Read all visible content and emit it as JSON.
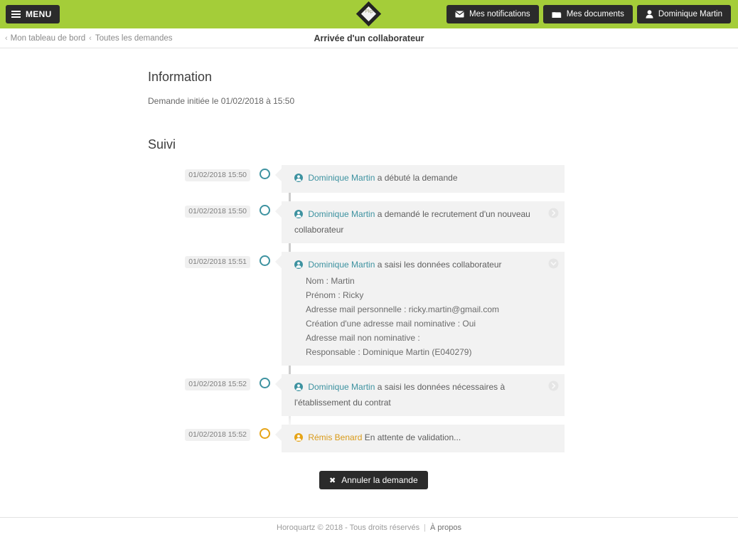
{
  "colors": {
    "brand_green": "#a4cd39",
    "dark": "#2b2b2b",
    "teal": "#3d92a0",
    "amber": "#e6a417",
    "card_bg": "#f2f2f2"
  },
  "header": {
    "menu_label": "MENU",
    "logo_text": "Pkp",
    "actions": [
      {
        "label": "Mes notifications",
        "icon": "envelope-icon"
      },
      {
        "label": "Mes documents",
        "icon": "folder-icon"
      },
      {
        "label": "Dominique Martin",
        "icon": "user-icon"
      }
    ]
  },
  "breadcrumb": {
    "items": [
      "Mon tableau de bord",
      "Toutes les demandes"
    ],
    "chevron": "‹"
  },
  "page_title": "Arrivée d'un collaborateur",
  "information": {
    "heading": "Information",
    "line": "Demande initiée le 01/02/2018 à 15:50"
  },
  "suivi": {
    "heading": "Suivi",
    "events": [
      {
        "time": "01/02/2018 15:50",
        "actor": "Dominique Martin",
        "action": "a débuté la demande",
        "state": "done",
        "toggle": null,
        "details": []
      },
      {
        "time": "01/02/2018 15:50",
        "actor": "Dominique Martin",
        "action": "a demandé le recrutement d'un nouveau collaborateur",
        "state": "done",
        "toggle": "chevron-right-icon",
        "details": []
      },
      {
        "time": "01/02/2018 15:51",
        "actor": "Dominique Martin",
        "action": "a saisi les données collaborateur",
        "state": "done",
        "toggle": "chevron-down-icon",
        "details": [
          "Nom : Martin",
          "Prénom : Ricky",
          "Adresse mail personnelle : ricky.martin@gmail.com",
          "Création d'une adresse mail nominative : Oui",
          "Adresse mail non nominative :",
          "Responsable : Dominique Martin (E040279)"
        ]
      },
      {
        "time": "01/02/2018 15:52",
        "actor": "Dominique Martin",
        "action": "a saisi les données nécessaires à l'établissement du contrat",
        "state": "done",
        "toggle": "chevron-right-icon",
        "details": []
      },
      {
        "time": "01/02/2018 15:52",
        "actor": "Rémis Benard",
        "action": "En attente de validation...",
        "state": "pending",
        "toggle": null,
        "details": []
      }
    ]
  },
  "cancel_button": {
    "label": "Annuler la demande",
    "icon": "close-icon",
    "glyph": "✖"
  },
  "footer": {
    "copyright": "Horoquartz © 2018 - Tous droits réservés",
    "separator": "|",
    "about": "À propos"
  }
}
